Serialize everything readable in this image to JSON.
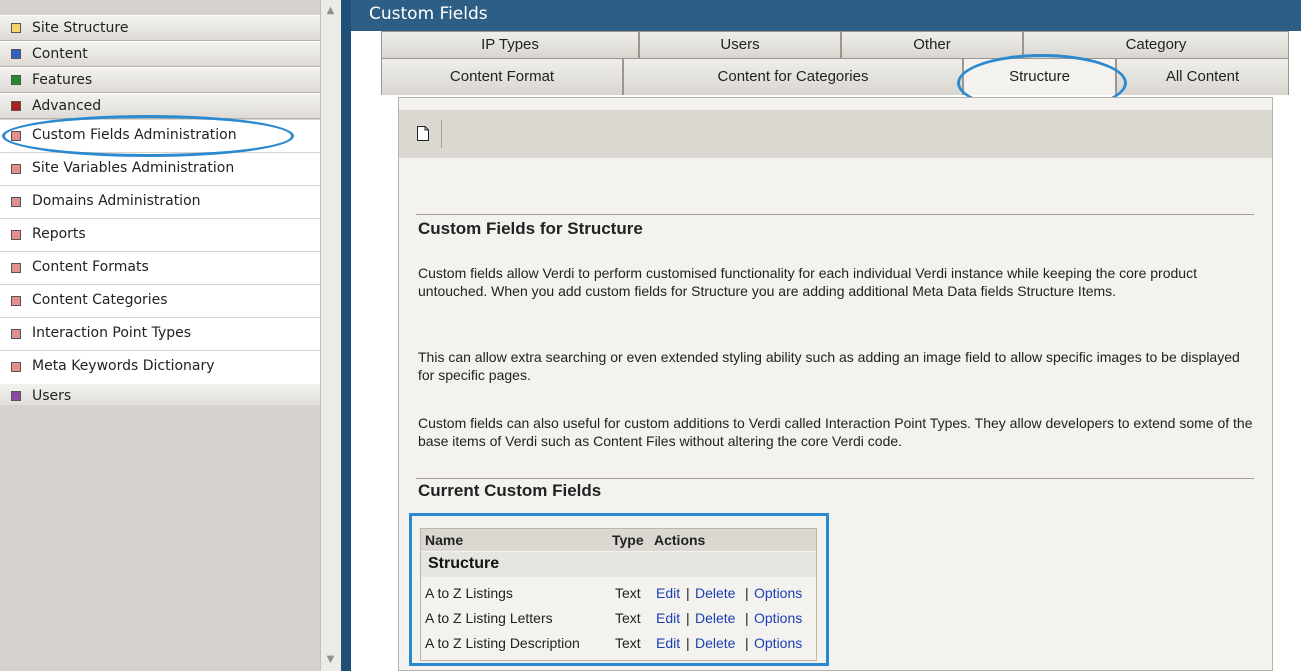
{
  "sidebar": {
    "tabs": [
      {
        "label": "Site Structure",
        "color": "#f3d36b"
      },
      {
        "label": "Content",
        "color": "#2f62c9"
      },
      {
        "label": "Features",
        "color": "#1f8a2e"
      },
      {
        "label": "Advanced",
        "color": "#b01e1e"
      }
    ],
    "items": [
      {
        "label": "Custom Fields Administration"
      },
      {
        "label": "Site Variables Administration"
      },
      {
        "label": "Domains Administration"
      },
      {
        "label": "Reports"
      },
      {
        "label": "Content Formats"
      },
      {
        "label": "Content Categories"
      },
      {
        "label": "Interaction Point Types"
      },
      {
        "label": "Meta Keywords Dictionary"
      }
    ],
    "item_color": "#e2908d",
    "users_tab": {
      "label": "Users",
      "color": "#8c4aa0"
    }
  },
  "main": {
    "title": "Custom Fields",
    "tabs_row1": [
      "IP Types",
      "Users",
      "Other",
      "Category"
    ],
    "tabs_row2": [
      "Content Format",
      "Content for Categories",
      "Structure",
      "All Content"
    ],
    "active_tab": "Structure",
    "section_title": "Custom Fields for Structure",
    "paragraphs": [
      "Custom fields allow Verdi to perform customised functionality for each individual Verdi instance while keeping the core product untouched. When you add custom fields for Structure you are adding additional Meta Data fields Structure Items.",
      "This can allow extra searching or even extended styling ability such as adding an image field to allow specific images to be displayed for specific pages.",
      "Custom fields can also useful for custom additions to Verdi called Interaction Point Types. They allow developers to extend some of the base items of Verdi such as Content Files without altering the core Verdi code."
    ],
    "current_title": "Current Custom Fields",
    "table": {
      "headers": {
        "name": "Name",
        "type": "Type",
        "actions": "Actions"
      },
      "section": "Structure",
      "rows": [
        {
          "name": "A to Z Listings",
          "type": "Text",
          "edit": "Edit",
          "delete": "Delete",
          "options": "Options"
        },
        {
          "name": "A to Z Listing Letters",
          "type": "Text",
          "edit": "Edit",
          "delete": "Delete",
          "options": "Options"
        },
        {
          "name": "A to Z Listing Description",
          "type": "Text",
          "edit": "Edit",
          "delete": "Delete",
          "options": "Options"
        }
      ],
      "separator": "|"
    }
  },
  "colors": {
    "header": "#2c5e86",
    "highlight": "#2b89cf",
    "link": "#1d3fb5"
  }
}
